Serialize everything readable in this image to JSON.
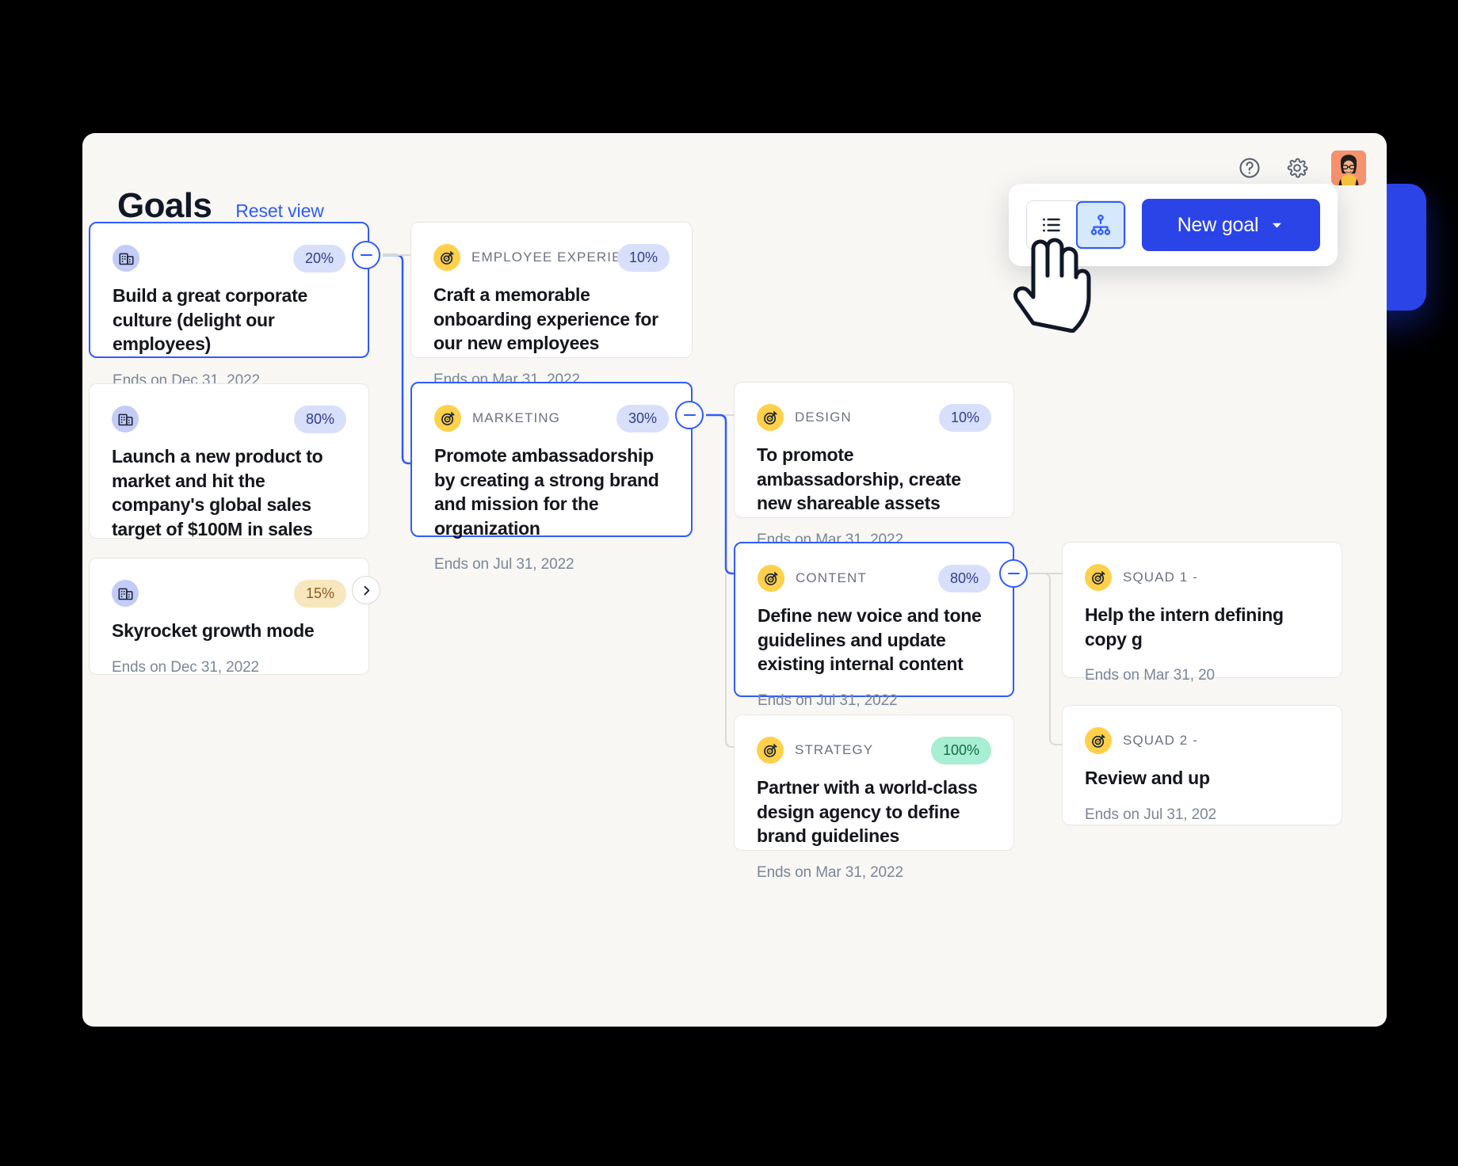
{
  "header": {
    "title": "Goals",
    "reset_link": "Reset view",
    "help_icon": "help-circle-icon",
    "settings_icon": "gear-icon",
    "avatar_alt": "user-avatar"
  },
  "toolbar": {
    "list_view_icon": "list-view-icon",
    "tree_view_icon": "tree-view-icon",
    "new_goal_label": "New goal",
    "dropdown_icon": "chevron-down-icon",
    "active_view": "tree"
  },
  "colors": {
    "accent_blue": "#2F5BFF",
    "button_blue": "#2B44E8",
    "badge_blue_bg": "#D8DFFB",
    "badge_amber_bg": "#F7E6BE",
    "badge_green_bg": "#A8EED2",
    "target_icon_bg": "#FFD04B",
    "building_icon_bg": "#C3CCF7",
    "canvas_bg": "#F8F7F4"
  },
  "goals": {
    "company": [
      {
        "id": "g1",
        "icon": "building-icon",
        "percent": "20%",
        "percent_tone": "blue",
        "title": "Build a great corporate culture (delight our employees)",
        "date": "Ends on Dec 31, 2022",
        "selected": true,
        "node_control": "collapse"
      },
      {
        "id": "g2",
        "icon": "building-icon",
        "percent": "80%",
        "percent_tone": "blue",
        "title": "Launch a new product to market and hit the company's global sales target of $100M in sales",
        "date": "Ends on Dec 31, 2022",
        "selected": false,
        "node_control": "none"
      },
      {
        "id": "g3",
        "icon": "building-icon",
        "percent": "15%",
        "percent_tone": "amber",
        "title": "Skyrocket growth mode",
        "date": "Ends on Dec 31, 2022",
        "selected": false,
        "node_control": "expand"
      }
    ],
    "level2": [
      {
        "id": "g4",
        "icon": "target-icon",
        "team": "EMPLOYEE EXPERIENCE",
        "percent": "10%",
        "percent_tone": "blue",
        "title": "Craft a memorable onboarding experience for our new employees",
        "date": "Ends on Mar 31, 2022",
        "selected": false,
        "node_control": "none"
      },
      {
        "id": "g5",
        "icon": "target-icon",
        "team": "MARKETING",
        "percent": "30%",
        "percent_tone": "blue",
        "title": "Promote ambassadorship by creating a strong brand and mission for the organization",
        "date": "Ends on Jul 31, 2022",
        "selected": true,
        "node_control": "collapse"
      }
    ],
    "level3": [
      {
        "id": "g6",
        "icon": "target-icon",
        "team": "DESIGN",
        "percent": "10%",
        "percent_tone": "blue",
        "title": "To promote ambassadorship, create new shareable assets",
        "date": "Ends on Mar 31, 2022",
        "selected": false,
        "node_control": "none"
      },
      {
        "id": "g7",
        "icon": "target-icon",
        "team": "CONTENT",
        "percent": "80%",
        "percent_tone": "blue",
        "title": "Define new voice and tone guidelines and update existing internal content",
        "date": "Ends on Jul 31, 2022",
        "selected": true,
        "node_control": "collapse"
      },
      {
        "id": "g8",
        "icon": "target-icon",
        "team": "STRATEGY",
        "percent": "100%",
        "percent_tone": "green",
        "title": "Partner with a world-class design agency to define brand guidelines",
        "date": "Ends on Mar 31, 2022",
        "selected": false,
        "node_control": "none"
      }
    ],
    "level4": [
      {
        "id": "g9",
        "icon": "target-icon",
        "team": "SQUAD 1 - ",
        "title": "Help the intern defining copy g",
        "date": "Ends on Mar 31, 20",
        "clipped": true
      },
      {
        "id": "g10",
        "icon": "target-icon",
        "team": "SQUAD 2 - ",
        "title": "Review and up",
        "date": "Ends on Jul 31, 202",
        "clipped": true
      }
    ]
  }
}
